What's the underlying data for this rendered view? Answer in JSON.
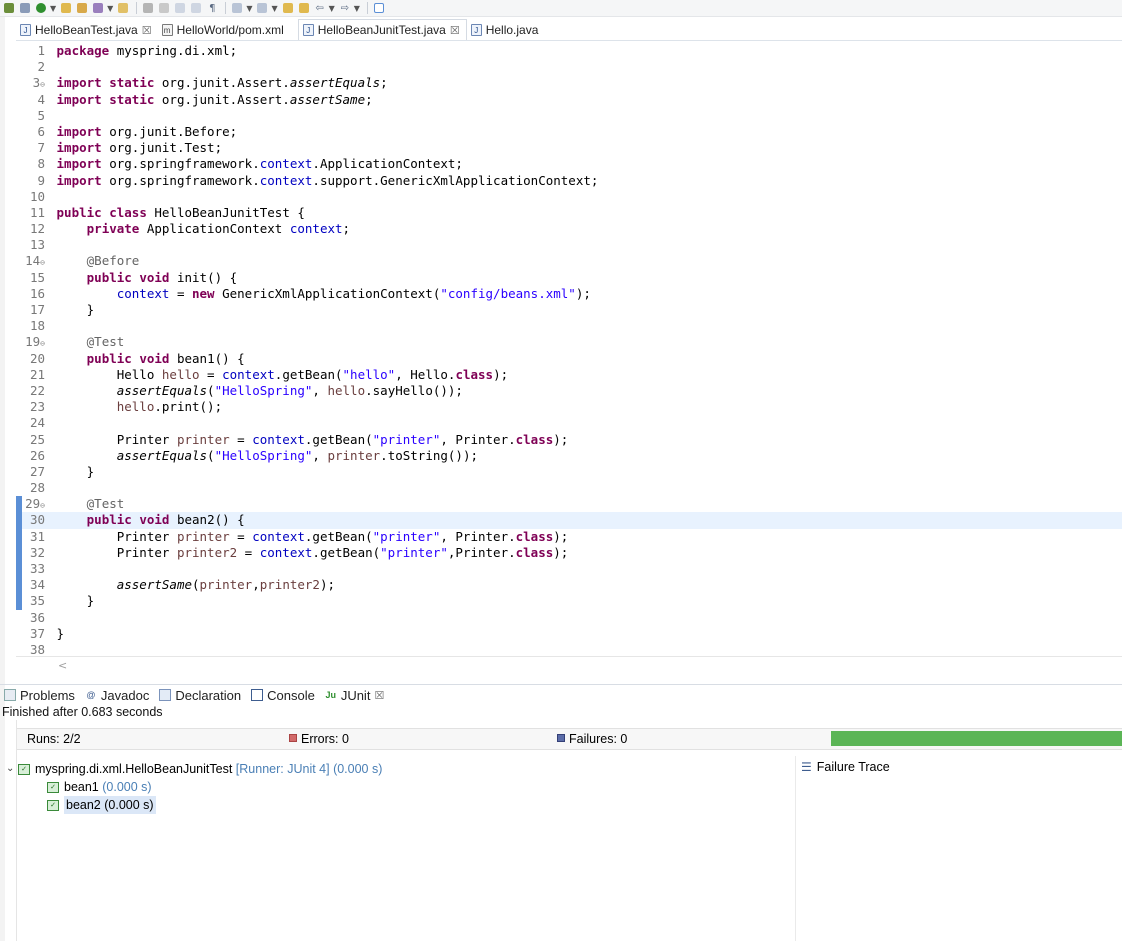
{
  "editor_tabs": [
    {
      "label": "HelloBeanTest.java",
      "close": "☒",
      "active": false
    },
    {
      "label": "HelloWorld/pom.xml",
      "close": "",
      "active": false
    },
    {
      "label": "HelloBeanJunitTest.java",
      "close": "☒",
      "active": true
    },
    {
      "label": "Hello.java",
      "close": "",
      "active": false
    }
  ],
  "code_lines": [
    "package myspring.di.xml;",
    "",
    "import static org.junit.Assert.assertEquals;",
    "import static org.junit.Assert.assertSame;",
    "",
    "import org.junit.Before;",
    "import org.junit.Test;",
    "import org.springframework.context.ApplicationContext;",
    "import org.springframework.context.support.GenericXmlApplicationContext;",
    "",
    "public class HelloBeanJunitTest {",
    "    private ApplicationContext context;",
    "",
    "    @Before",
    "    public void init() {",
    "        context = new GenericXmlApplicationContext(\"config/beans.xml\");",
    "    }",
    "",
    "    @Test",
    "    public void bean1() {",
    "        Hello hello = context.getBean(\"hello\", Hello.class);",
    "        assertEquals(\"HelloSpring\", hello.sayHello());",
    "        hello.print();",
    "",
    "        Printer printer = context.getBean(\"printer\", Printer.class);",
    "        assertEquals(\"HelloSpring\", printer.toString());",
    "    }",
    "",
    "    @Test",
    "    public void bean2() {",
    "        Printer printer = context.getBean(\"printer\", Printer.class);",
    "        Printer printer2 = context.getBean(\"printer\",Printer.class);",
    "",
    "        assertSame(printer,printer2);",
    "    }",
    "",
    "}",
    ""
  ],
  "fold_markers": [
    "3",
    "14",
    "19",
    "29"
  ],
  "current_line": 30,
  "scroll_left_glyph": "<",
  "bottom_tabs": [
    {
      "label": "Problems",
      "icon": "problems-icon",
      "close": ""
    },
    {
      "label": "Javadoc",
      "icon": "javadoc-icon",
      "close": ""
    },
    {
      "label": "Declaration",
      "icon": "declaration-icon",
      "close": ""
    },
    {
      "label": "Console",
      "icon": "console-icon",
      "close": ""
    },
    {
      "label": "JUnit",
      "icon": "junit-icon",
      "close": "☒"
    }
  ],
  "junit": {
    "finished": "Finished after 0.683 seconds",
    "runs_label": "Runs: ",
    "runs": "2/2",
    "errors_label": "Errors: ",
    "errors": "0",
    "failures_label": "Failures: ",
    "failures": "0",
    "progress": 1.0,
    "progress_color": "#5bb556",
    "suite_name": "myspring.di.xml.HelloBeanJunitTest",
    "suite_meta": "[Runner: JUnit 4] (0.000 s)",
    "tests": [
      {
        "name": "bean1",
        "time": "(0.000 s)"
      },
      {
        "name": "bean2",
        "time": "(0.000 s)"
      }
    ],
    "failure_trace": "Failure Trace"
  },
  "colors": {
    "keyword": "#7f0055",
    "string": "#2a00ff",
    "field": "#0000c0",
    "annotation": "#646464"
  }
}
